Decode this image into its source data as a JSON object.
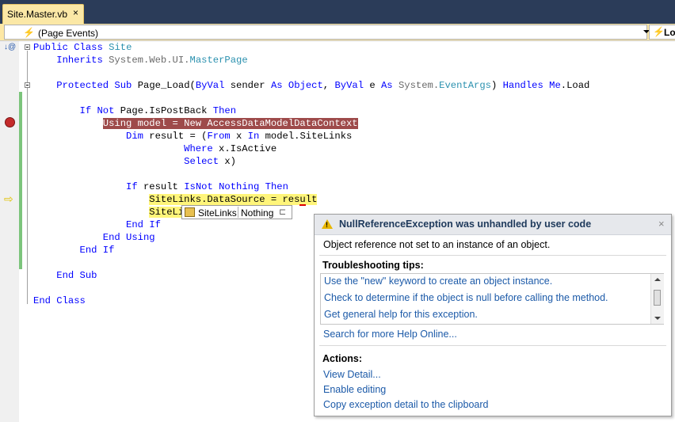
{
  "tab": {
    "label": "Site.Master.vb",
    "close": "×"
  },
  "navbar": {
    "left_label": "(Page Events)",
    "right_label": "Lo"
  },
  "code": {
    "l1": {
      "kw1": "Public",
      "kw2": "Class",
      "ty": "Site"
    },
    "l2": {
      "kw": "Inherits",
      "ty1": "System.Web.UI.",
      "ty2": "MasterPage"
    },
    "l3": {
      "kw1": "Protected",
      "kw2": "Sub",
      "t1": "Page_Load(",
      "kw3": "ByVal",
      "t2": " sender ",
      "kw4": "As",
      "kw5": "Object",
      "t3": ", ",
      "kw6": "ByVal",
      "t4": " e ",
      "kw7": "As",
      "ty1": "System.",
      "ty2": "EventArgs",
      "t5": ") ",
      "kw8": "Handles",
      "kw9": "Me",
      "t6": ".Load"
    },
    "l4": {
      "kw1": "If",
      "kw2": "Not",
      "t1": " Page.IsPostBack ",
      "kw3": "Then"
    },
    "l5": {
      "text": "Using model = New AccessDataModelDataContext"
    },
    "l6": {
      "kw1": "Dim",
      "t1": " result = (",
      "kw2": "From",
      "t2": " x ",
      "kw3": "In",
      "t3": " model.SiteLinks"
    },
    "l7": {
      "kw": "Where",
      "t": " x.IsActive"
    },
    "l8": {
      "kw": "Select",
      "t": " x)"
    },
    "l9": {
      "kw1": "If",
      "t1": " result ",
      "kw2": "IsNot",
      "kw3": "Nothing",
      "kw4": "Then"
    },
    "l10": {
      "text": "SiteLinks.DataSource = result"
    },
    "l11": {
      "text": "SiteLir"
    },
    "l12": {
      "kw1": "End",
      "kw2": "If"
    },
    "l13": {
      "kw1": "End",
      "kw2": "Using"
    },
    "l14": {
      "kw1": "End",
      "kw2": "If"
    },
    "l15": {
      "kw1": "End",
      "kw2": "Sub"
    },
    "l16": {
      "kw1": "End",
      "kw2": "Class"
    }
  },
  "datatip": {
    "name": "SiteLinks",
    "value": "Nothing"
  },
  "exception": {
    "title": "NullReferenceException was unhandled by user code",
    "close": "×",
    "message": "Object reference not set to an instance of an object.",
    "tips_header": "Troubleshooting tips:",
    "tips": [
      "Use the \"new\" keyword to create an object instance.",
      "Check to determine if the object is null before calling the method.",
      "Get general help for this exception."
    ],
    "search_link": "Search for more Help Online...",
    "actions_header": "Actions:",
    "actions": [
      "View Detail...",
      "Enable editing",
      "Copy exception detail to the clipboard"
    ]
  },
  "colors": {
    "breakpoint": "#c42b2b",
    "current_line": "#fff57a",
    "keyword": "#0000ff",
    "type": "#2b91af",
    "link": "#1c5aa8"
  }
}
